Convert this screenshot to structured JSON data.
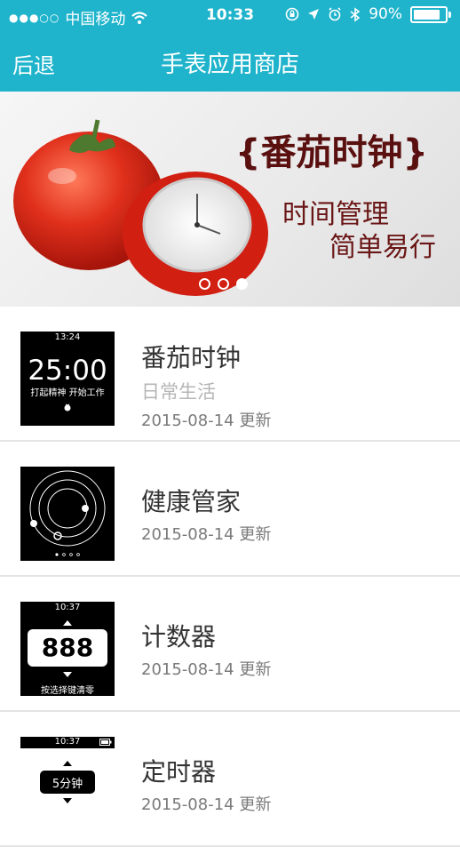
{
  "status_bar": {
    "signal_dots": "●●●○○",
    "carrier": "中国移动",
    "time": "10:33",
    "battery_percent": "90%",
    "battery_level": 0.9
  },
  "nav": {
    "back_label": "后退",
    "title": "手表应用商店"
  },
  "banner": {
    "title": "{番茄时钟}",
    "line1": "时间管理",
    "line2": "简单易行",
    "slide_count": 3,
    "active_slide": 3
  },
  "apps": [
    {
      "name": "番茄时钟",
      "category": "日常生活",
      "date": "2015-08-14 更新",
      "thumb": {
        "time": "13:24",
        "big": "25:00",
        "sub": "打起精神 开始工作"
      }
    },
    {
      "name": "健康管家",
      "date": "2015-08-14 更新"
    },
    {
      "name": "计数器",
      "date": "2015-08-14 更新",
      "thumb": {
        "time": "10:37",
        "value": "888",
        "sub": "按选择键清零"
      }
    },
    {
      "name": "定时器",
      "date": "2015-08-14 更新",
      "thumb": {
        "time": "10:37",
        "value": "5分钟"
      }
    }
  ]
}
